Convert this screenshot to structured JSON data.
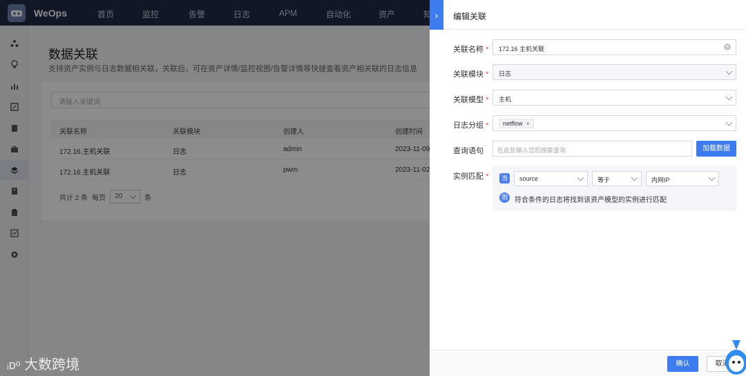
{
  "app": {
    "name": "WeOps"
  },
  "nav": [
    "首页",
    "监控",
    "告警",
    "日志",
    "APM",
    "自动化",
    "资产",
    "知"
  ],
  "sidebar_icons": [
    "topology-icon",
    "bulb-icon",
    "chart-icon",
    "edit-icon",
    "doc-icon",
    "briefcase-icon",
    "layers-icon",
    "book-icon",
    "clipboard-icon",
    "analytics-icon",
    "settings-icon"
  ],
  "page": {
    "title": "数据关联",
    "subtitle": "支持资产实例与日志数据相关联，关联后，可在资产详情/监控视图/告警详情等快捷查看资产相关联的日志信息",
    "search_placeholder": "请输入关键词",
    "columns": [
      "关联名称",
      "关联模块",
      "创建人",
      "创建时间"
    ],
    "rows": [
      [
        "172.16.主机关联",
        "日志",
        "admin",
        "2023-11-09"
      ],
      [
        "172.16.主机关联",
        "日志",
        "pwm",
        "2023-11-02"
      ]
    ],
    "pager": {
      "total": "共计 2 条",
      "per_page_label": "每页",
      "per_page": "20",
      "unit": "条"
    }
  },
  "watermark": "大数跨境",
  "drawer": {
    "title": "编辑关联",
    "fields": {
      "name": {
        "label": "关联名称",
        "value": "172.16      主机关联"
      },
      "module": {
        "label": "关联模块",
        "value": "日志"
      },
      "model": {
        "label": "关联模型",
        "value": "主机"
      },
      "log_group": {
        "label": "日志分组",
        "tag": "netflow"
      },
      "query": {
        "label": "查询语句",
        "placeholder": "在此处输入您的搜索查询",
        "button": "加载数据"
      },
      "match": {
        "label": "实例匹配",
        "when_badge": "当",
        "then_badge": "则",
        "source_field": "source",
        "operator": "等于",
        "target": "内网IP",
        "result_text": "符合条件的日志将找到该资产模型的实例进行匹配"
      }
    },
    "confirm": "确认",
    "cancel": "取消"
  }
}
